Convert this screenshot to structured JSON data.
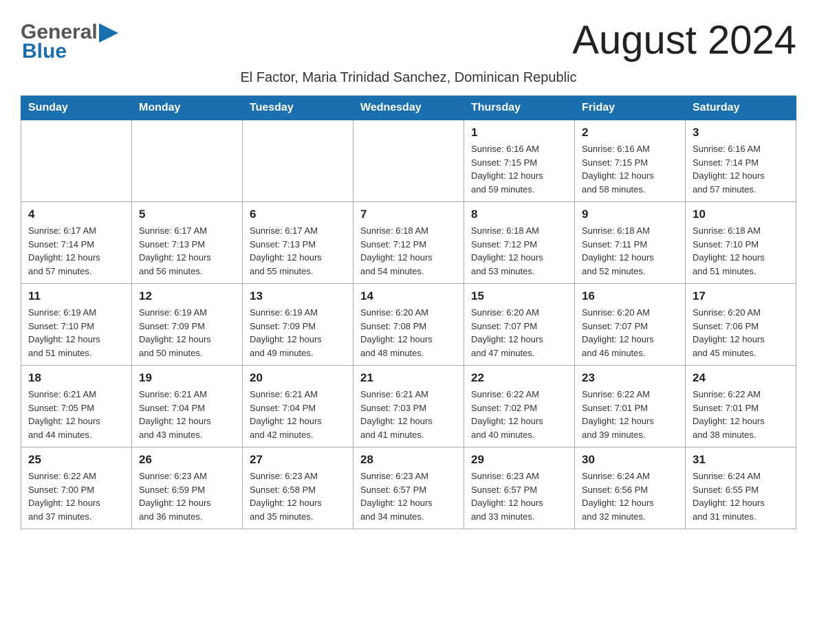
{
  "header": {
    "logo_general": "General",
    "logo_blue": "Blue",
    "month_title": "August 2024",
    "subtitle": "El Factor, Maria Trinidad Sanchez, Dominican Republic"
  },
  "days_of_week": [
    "Sunday",
    "Monday",
    "Tuesday",
    "Wednesday",
    "Thursday",
    "Friday",
    "Saturday"
  ],
  "weeks": [
    {
      "days": [
        {
          "num": "",
          "info": ""
        },
        {
          "num": "",
          "info": ""
        },
        {
          "num": "",
          "info": ""
        },
        {
          "num": "",
          "info": ""
        },
        {
          "num": "1",
          "info": "Sunrise: 6:16 AM\nSunset: 7:15 PM\nDaylight: 12 hours\nand 59 minutes."
        },
        {
          "num": "2",
          "info": "Sunrise: 6:16 AM\nSunset: 7:15 PM\nDaylight: 12 hours\nand 58 minutes."
        },
        {
          "num": "3",
          "info": "Sunrise: 6:16 AM\nSunset: 7:14 PM\nDaylight: 12 hours\nand 57 minutes."
        }
      ]
    },
    {
      "days": [
        {
          "num": "4",
          "info": "Sunrise: 6:17 AM\nSunset: 7:14 PM\nDaylight: 12 hours\nand 57 minutes."
        },
        {
          "num": "5",
          "info": "Sunrise: 6:17 AM\nSunset: 7:13 PM\nDaylight: 12 hours\nand 56 minutes."
        },
        {
          "num": "6",
          "info": "Sunrise: 6:17 AM\nSunset: 7:13 PM\nDaylight: 12 hours\nand 55 minutes."
        },
        {
          "num": "7",
          "info": "Sunrise: 6:18 AM\nSunset: 7:12 PM\nDaylight: 12 hours\nand 54 minutes."
        },
        {
          "num": "8",
          "info": "Sunrise: 6:18 AM\nSunset: 7:12 PM\nDaylight: 12 hours\nand 53 minutes."
        },
        {
          "num": "9",
          "info": "Sunrise: 6:18 AM\nSunset: 7:11 PM\nDaylight: 12 hours\nand 52 minutes."
        },
        {
          "num": "10",
          "info": "Sunrise: 6:18 AM\nSunset: 7:10 PM\nDaylight: 12 hours\nand 51 minutes."
        }
      ]
    },
    {
      "days": [
        {
          "num": "11",
          "info": "Sunrise: 6:19 AM\nSunset: 7:10 PM\nDaylight: 12 hours\nand 51 minutes."
        },
        {
          "num": "12",
          "info": "Sunrise: 6:19 AM\nSunset: 7:09 PM\nDaylight: 12 hours\nand 50 minutes."
        },
        {
          "num": "13",
          "info": "Sunrise: 6:19 AM\nSunset: 7:09 PM\nDaylight: 12 hours\nand 49 minutes."
        },
        {
          "num": "14",
          "info": "Sunrise: 6:20 AM\nSunset: 7:08 PM\nDaylight: 12 hours\nand 48 minutes."
        },
        {
          "num": "15",
          "info": "Sunrise: 6:20 AM\nSunset: 7:07 PM\nDaylight: 12 hours\nand 47 minutes."
        },
        {
          "num": "16",
          "info": "Sunrise: 6:20 AM\nSunset: 7:07 PM\nDaylight: 12 hours\nand 46 minutes."
        },
        {
          "num": "17",
          "info": "Sunrise: 6:20 AM\nSunset: 7:06 PM\nDaylight: 12 hours\nand 45 minutes."
        }
      ]
    },
    {
      "days": [
        {
          "num": "18",
          "info": "Sunrise: 6:21 AM\nSunset: 7:05 PM\nDaylight: 12 hours\nand 44 minutes."
        },
        {
          "num": "19",
          "info": "Sunrise: 6:21 AM\nSunset: 7:04 PM\nDaylight: 12 hours\nand 43 minutes."
        },
        {
          "num": "20",
          "info": "Sunrise: 6:21 AM\nSunset: 7:04 PM\nDaylight: 12 hours\nand 42 minutes."
        },
        {
          "num": "21",
          "info": "Sunrise: 6:21 AM\nSunset: 7:03 PM\nDaylight: 12 hours\nand 41 minutes."
        },
        {
          "num": "22",
          "info": "Sunrise: 6:22 AM\nSunset: 7:02 PM\nDaylight: 12 hours\nand 40 minutes."
        },
        {
          "num": "23",
          "info": "Sunrise: 6:22 AM\nSunset: 7:01 PM\nDaylight: 12 hours\nand 39 minutes."
        },
        {
          "num": "24",
          "info": "Sunrise: 6:22 AM\nSunset: 7:01 PM\nDaylight: 12 hours\nand 38 minutes."
        }
      ]
    },
    {
      "days": [
        {
          "num": "25",
          "info": "Sunrise: 6:22 AM\nSunset: 7:00 PM\nDaylight: 12 hours\nand 37 minutes."
        },
        {
          "num": "26",
          "info": "Sunrise: 6:23 AM\nSunset: 6:59 PM\nDaylight: 12 hours\nand 36 minutes."
        },
        {
          "num": "27",
          "info": "Sunrise: 6:23 AM\nSunset: 6:58 PM\nDaylight: 12 hours\nand 35 minutes."
        },
        {
          "num": "28",
          "info": "Sunrise: 6:23 AM\nSunset: 6:57 PM\nDaylight: 12 hours\nand 34 minutes."
        },
        {
          "num": "29",
          "info": "Sunrise: 6:23 AM\nSunset: 6:57 PM\nDaylight: 12 hours\nand 33 minutes."
        },
        {
          "num": "30",
          "info": "Sunrise: 6:24 AM\nSunset: 6:56 PM\nDaylight: 12 hours\nand 32 minutes."
        },
        {
          "num": "31",
          "info": "Sunrise: 6:24 AM\nSunset: 6:55 PM\nDaylight: 12 hours\nand 31 minutes."
        }
      ]
    }
  ]
}
